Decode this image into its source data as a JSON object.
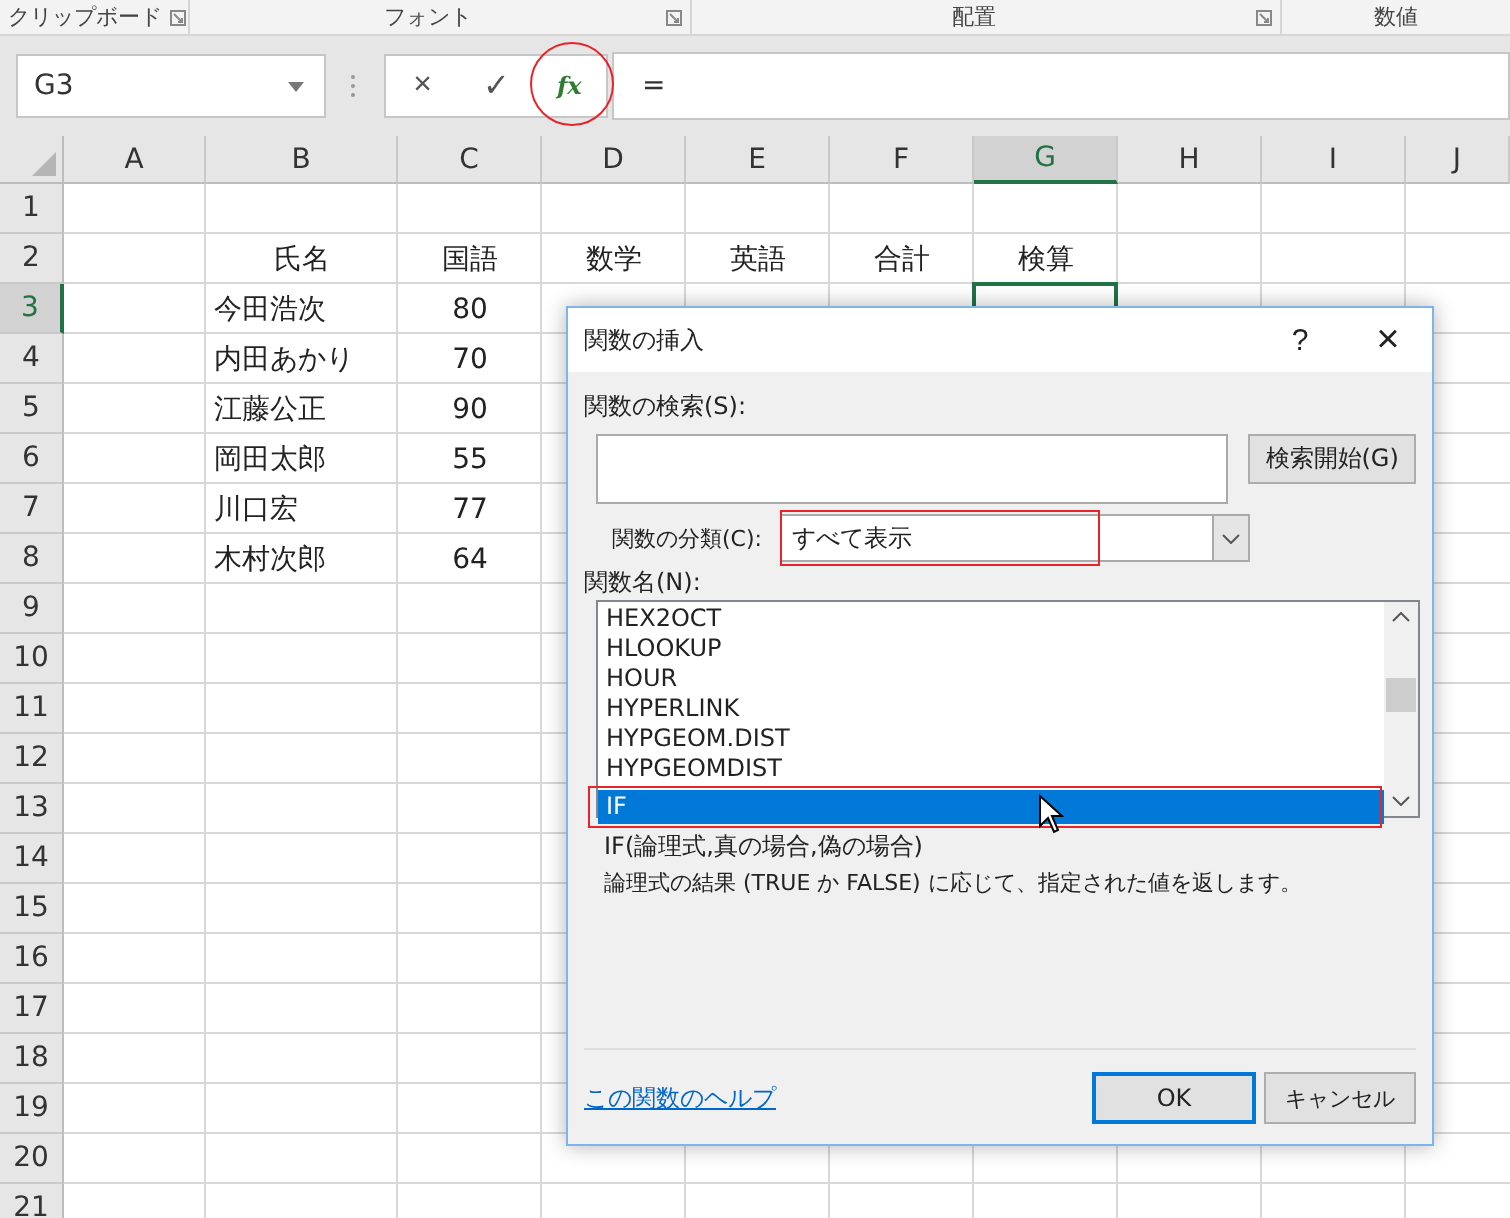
{
  "ribbon_groups": [
    {
      "label": "クリップボード",
      "launcher": true
    },
    {
      "label": "フォント",
      "launcher": true
    },
    {
      "label": "配置",
      "launcher": true
    },
    {
      "label": "数値",
      "launcher": false
    }
  ],
  "formula_bar": {
    "name_box": "G3",
    "cancel": "×",
    "enter": "✓",
    "insert_function": "fx",
    "insert_function_highlighted": true,
    "formula": "="
  },
  "columns": [
    {
      "label": "A",
      "selected": false
    },
    {
      "label": "B",
      "selected": false
    },
    {
      "label": "C",
      "selected": false
    },
    {
      "label": "D",
      "selected": false
    },
    {
      "label": "E",
      "selected": false
    },
    {
      "label": "F",
      "selected": false
    },
    {
      "label": "G",
      "selected": true
    },
    {
      "label": "H",
      "selected": false
    },
    {
      "label": "I",
      "selected": false
    },
    {
      "label": "J",
      "selected": false
    }
  ],
  "rows": [
    {
      "label": "1",
      "selected": false
    },
    {
      "label": "2",
      "selected": false,
      "cells": {
        "B": {
          "text": "氏名",
          "kind": "centered"
        },
        "C": {
          "text": "国語",
          "kind": "centered"
        },
        "D": {
          "text": "数学",
          "kind": "centered"
        },
        "E": {
          "text": "英語",
          "kind": "centered"
        },
        "F": {
          "text": "合計",
          "kind": "centered"
        },
        "G": {
          "text": "検算",
          "kind": "centered"
        }
      }
    },
    {
      "label": "3",
      "selected": true,
      "cells": {
        "B": {
          "text": "今田浩次",
          "kind": "text"
        },
        "C": {
          "text": "80",
          "kind": "centered"
        }
      }
    },
    {
      "label": "4",
      "selected": false,
      "cells": {
        "B": {
          "text": "内田あかり",
          "kind": "text"
        },
        "C": {
          "text": "70",
          "kind": "centered"
        }
      }
    },
    {
      "label": "5",
      "selected": false,
      "cells": {
        "B": {
          "text": "江藤公正",
          "kind": "text"
        },
        "C": {
          "text": "90",
          "kind": "centered"
        }
      }
    },
    {
      "label": "6",
      "selected": false,
      "cells": {
        "B": {
          "text": "岡田太郎",
          "kind": "text"
        },
        "C": {
          "text": "55",
          "kind": "centered"
        }
      }
    },
    {
      "label": "7",
      "selected": false,
      "cells": {
        "B": {
          "text": "川口宏",
          "kind": "text"
        },
        "C": {
          "text": "77",
          "kind": "centered"
        }
      }
    },
    {
      "label": "8",
      "selected": false,
      "cells": {
        "B": {
          "text": "木村次郎",
          "kind": "text"
        },
        "C": {
          "text": "64",
          "kind": "centered"
        }
      }
    },
    {
      "label": "9",
      "selected": false
    },
    {
      "label": "10",
      "selected": false
    },
    {
      "label": "11",
      "selected": false
    },
    {
      "label": "12",
      "selected": false
    },
    {
      "label": "13",
      "selected": false
    },
    {
      "label": "14",
      "selected": false
    },
    {
      "label": "15",
      "selected": false
    },
    {
      "label": "16",
      "selected": false
    },
    {
      "label": "17",
      "selected": false
    },
    {
      "label": "18",
      "selected": false
    },
    {
      "label": "19",
      "selected": false
    },
    {
      "label": "20",
      "selected": false
    },
    {
      "label": "21",
      "selected": false
    }
  ],
  "dialog": {
    "title": "関数の挿入",
    "help_button": "?",
    "close_button": "×",
    "search_label": "関数の検索(S):",
    "search_button": "検索開始(G)",
    "category_label": "関数の分類(C):",
    "category_value": "すべて表示",
    "category_highlighted": true,
    "list_label": "関数名(N):",
    "functions": [
      {
        "name": "HEX2OCT",
        "selected": false,
        "highlighted": false
      },
      {
        "name": "HLOOKUP",
        "selected": false,
        "highlighted": false
      },
      {
        "name": "HOUR",
        "selected": false,
        "highlighted": false
      },
      {
        "name": "HYPERLINK",
        "selected": false,
        "highlighted": false
      },
      {
        "name": "HYPGEOM.DIST",
        "selected": false,
        "highlighted": false
      },
      {
        "name": "HYPGEOMDIST",
        "selected": false,
        "highlighted": false
      },
      {
        "name": "IF",
        "selected": true,
        "highlighted": true
      }
    ],
    "syntax": "IF(論理式,真の場合,偽の場合)",
    "description": "論理式の結果 (TRUE か FALSE) に応じて、指定された値を返します。",
    "help_link": "この関数のヘルプ",
    "ok_button": "OK",
    "cancel_button": "キャンセル"
  }
}
